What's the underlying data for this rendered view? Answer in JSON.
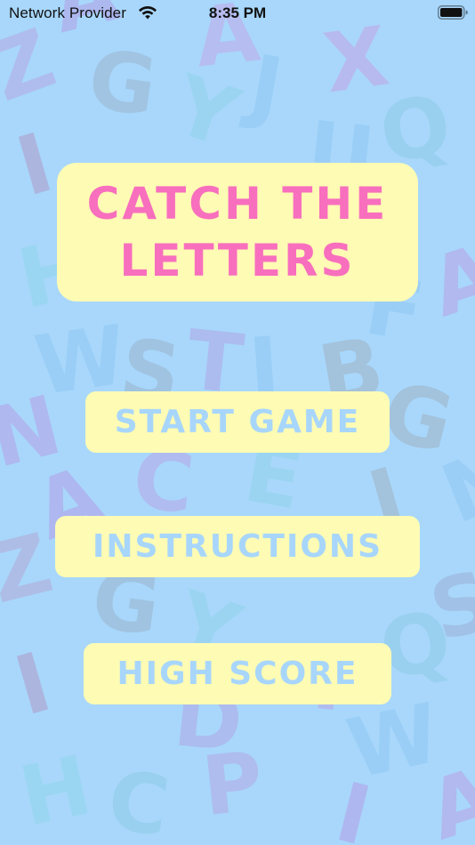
{
  "status_bar": {
    "carrier": "Network Provider",
    "time": "8:35 PM"
  },
  "title": "CATCH THE\nLETTERS",
  "menu": {
    "start_label": "START GAME",
    "instructions_label": "INSTRUCTIONS",
    "high_score_label": "HIGH SCORE"
  },
  "icons": {
    "wifi": "wifi-icon",
    "battery": "battery-icon"
  },
  "colors": {
    "background": "#a8d7fb",
    "panel": "#fdfbb4",
    "title_text": "#f86fbe",
    "button_text": "#a8d6fb"
  },
  "background_letters": [
    "A",
    "Z",
    "G",
    "A",
    "Y",
    "J",
    "X",
    "I",
    "U",
    "Q",
    "H",
    "F",
    "A",
    "N",
    "S",
    "T",
    "J",
    "B",
    "W",
    "G",
    "N",
    "E",
    "A",
    "C",
    "J",
    "Z",
    "S",
    "G",
    "Y",
    "Q",
    "P",
    "I",
    "D",
    "W",
    "H",
    "C",
    "P",
    "I",
    "A"
  ]
}
